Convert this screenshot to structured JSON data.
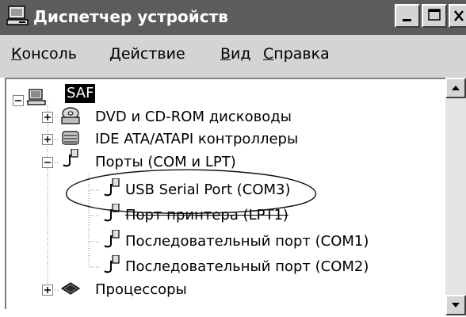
{
  "window": {
    "title": "Диспетчер устройств"
  },
  "menu": [
    {
      "label": "Консоль"
    },
    {
      "label": "Действие"
    },
    {
      "label": "Вид"
    },
    {
      "label": "Справка"
    }
  ],
  "tree": {
    "root": "SAF",
    "dvd": "DVD и CD-ROM дисководы",
    "ide": "IDE ATA/ATAPI контроллеры",
    "ports": "Порты (COM и LPT)",
    "usb_serial": "USB Serial Port (COM3)",
    "printer_port": "Порт принтера (LPT1)",
    "com1": "Последовательный порт (COM1)",
    "com2": "Последовательный порт (COM2)",
    "cpu": "Процессоры"
  },
  "colors": {
    "titlebar": "#5c5c5c",
    "menubar": "#d4d4d4",
    "selection": "#000000"
  }
}
